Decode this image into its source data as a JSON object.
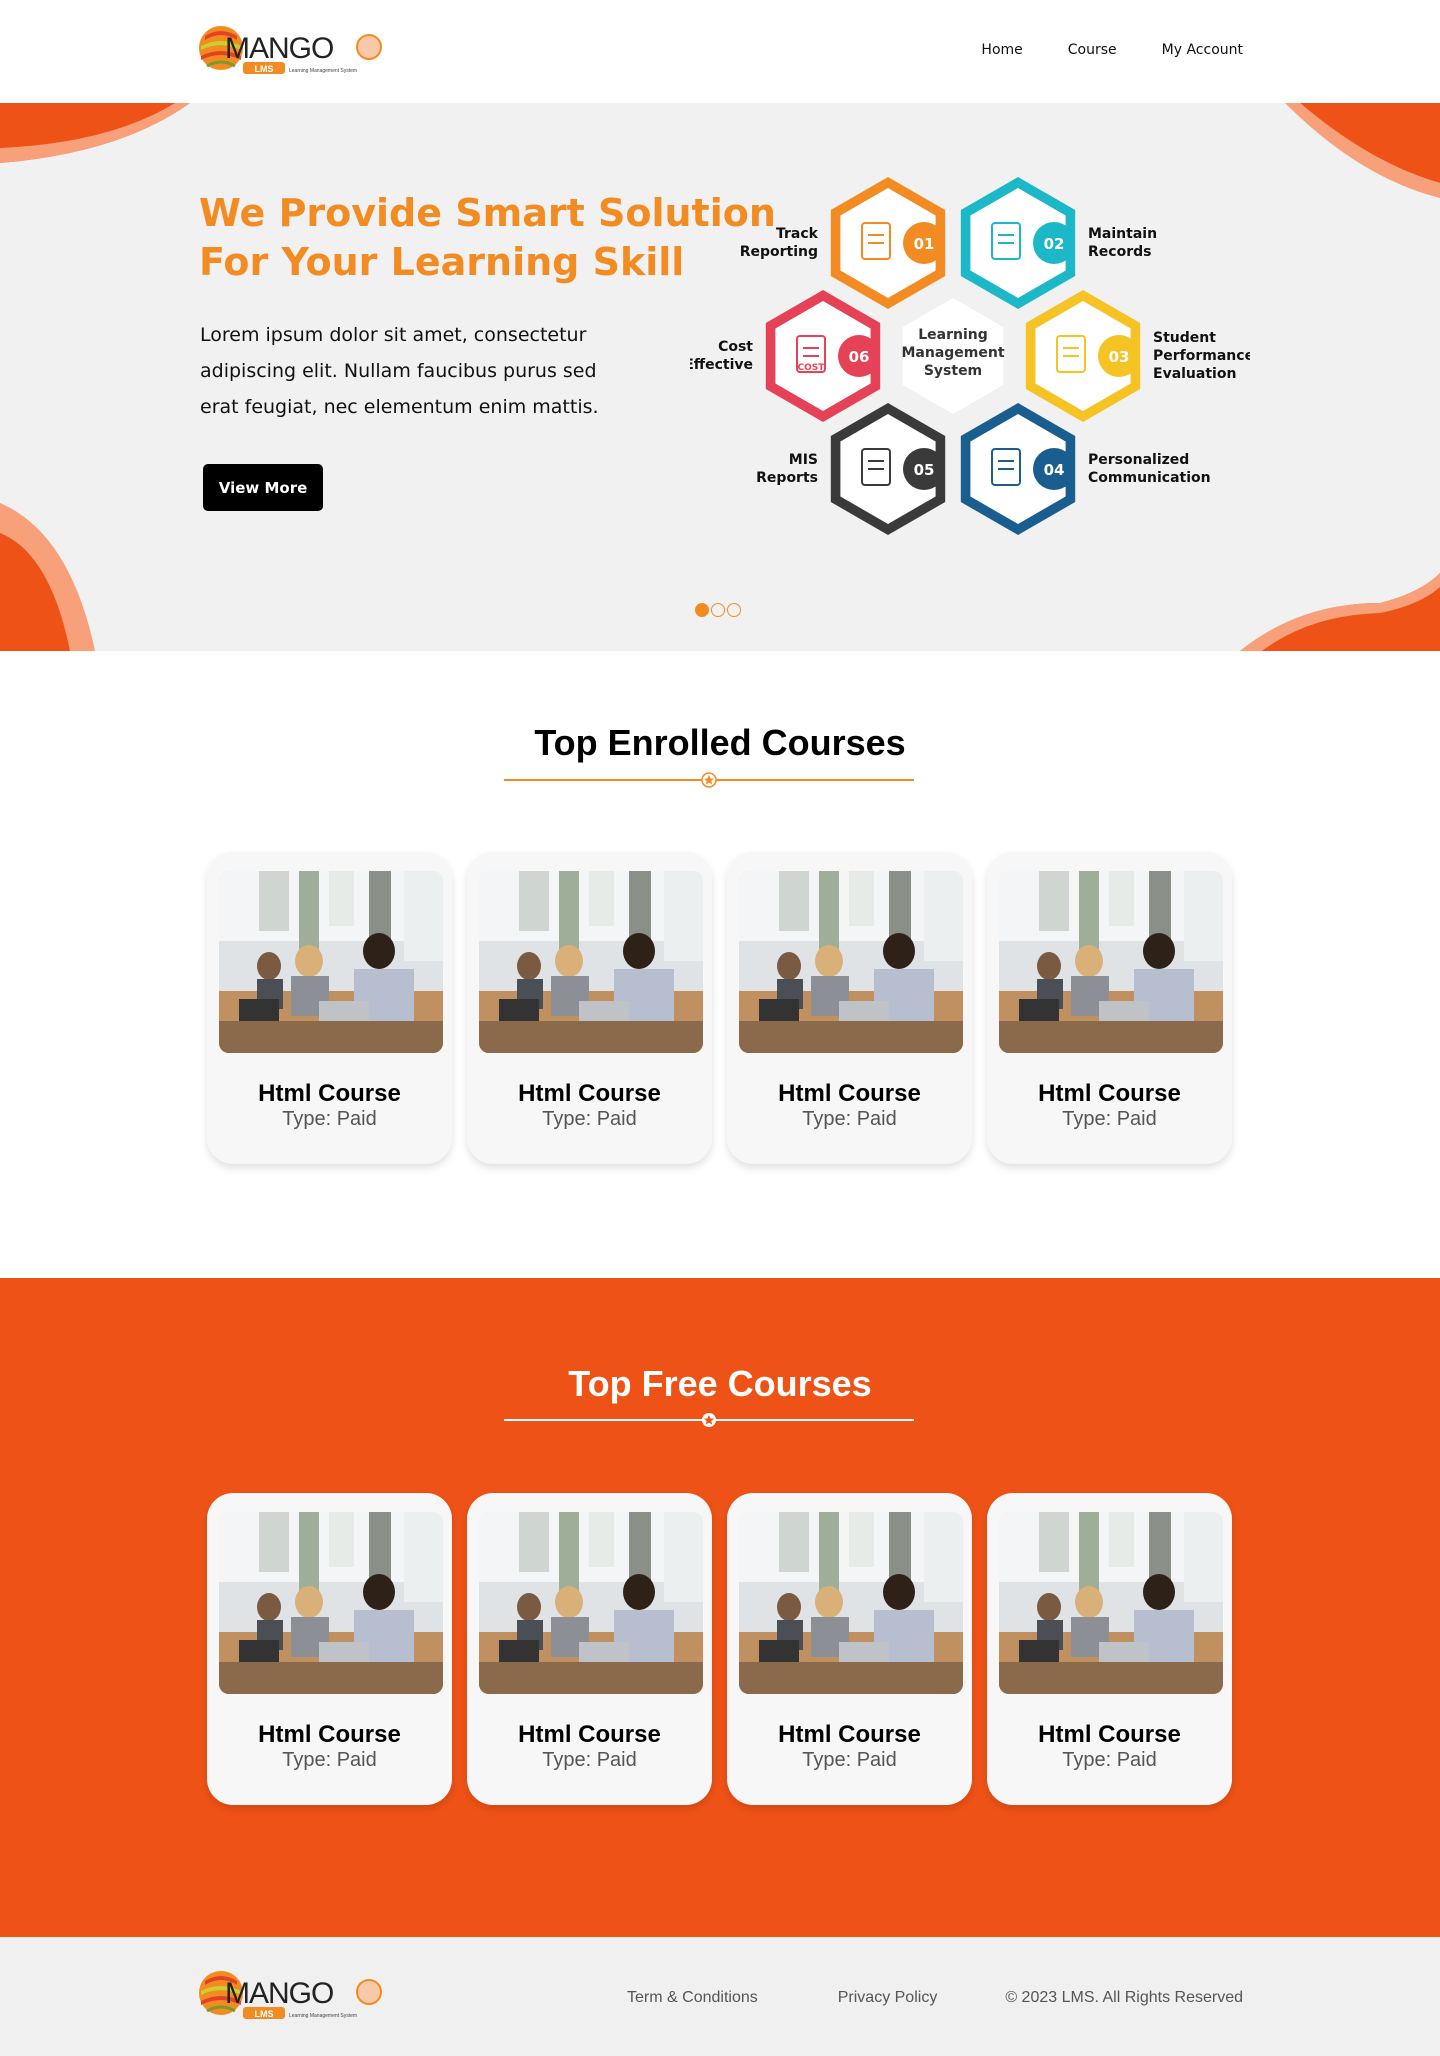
{
  "header": {
    "logo": {
      "brand": "MANGO",
      "badge": "LMS",
      "tagline": "Learning Management System"
    },
    "nav": [
      "Home",
      "Course",
      "My Account"
    ]
  },
  "hero": {
    "title_line1": "We Provide Smart Solution",
    "title_line2": "For Your Learning Skill",
    "text": "Lorem ipsum dolor sit amet, consectetur adipiscing elit. Nullam faucibus purus sed erat feugiat, nec elementum enim mattis.",
    "button": "View More",
    "diagram": {
      "center": [
        "Learning",
        "Management",
        "System"
      ],
      "items": [
        {
          "num": "01",
          "label": [
            "Track",
            "Reporting"
          ],
          "color": "#f28c22"
        },
        {
          "num": "02",
          "label": [
            "Maintain",
            "Records"
          ],
          "color": "#1cb8c7"
        },
        {
          "num": "03",
          "label": [
            "Student",
            "Performance",
            "Evaluation"
          ],
          "color": "#f6c324"
        },
        {
          "num": "04",
          "label": [
            "Personalized",
            "Communication"
          ],
          "color": "#1a5e8f"
        },
        {
          "num": "05",
          "label": [
            "MIS",
            "Reports"
          ],
          "color": "#3a3a3a"
        },
        {
          "num": "06",
          "label": [
            "Cost",
            "Effective"
          ],
          "color": "#e54257",
          "icon_text": "COST"
        }
      ]
    },
    "slides": 3,
    "active_slide": 0
  },
  "enrolled": {
    "heading": "Top Enrolled Courses",
    "courses": [
      {
        "title": "Html Course",
        "type": "Type: Paid"
      },
      {
        "title": "Html Course",
        "type": "Type: Paid"
      },
      {
        "title": "Html Course",
        "type": "Type: Paid"
      },
      {
        "title": "Html Course",
        "type": "Type: Paid"
      }
    ]
  },
  "free": {
    "heading": "Top Free Courses",
    "courses": [
      {
        "title": "Html Course",
        "type": "Type: Paid"
      },
      {
        "title": "Html Course",
        "type": "Type: Paid"
      },
      {
        "title": "Html Course",
        "type": "Type: Paid"
      },
      {
        "title": "Html Course",
        "type": "Type: Paid"
      }
    ]
  },
  "footer": {
    "links": [
      "Term & Conditions",
      "Privacy Policy"
    ],
    "copyright": "© 2023 LMS. All Rights Reserved"
  },
  "colors": {
    "accent_orange": "#f28c22",
    "section_orange": "#ef5216",
    "hero_bg": "#f1f1f1"
  }
}
